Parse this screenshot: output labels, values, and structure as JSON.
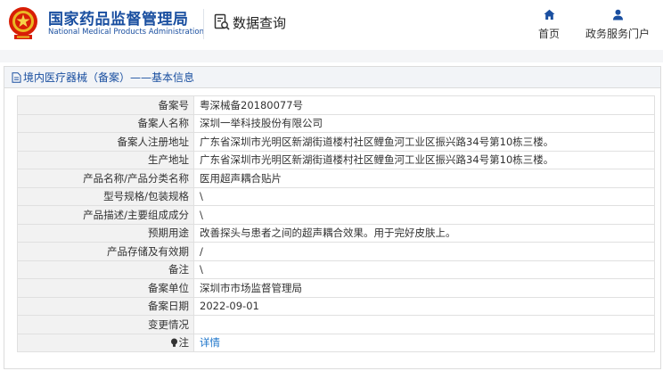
{
  "header": {
    "brand_cn": "国家药品监督管理局",
    "brand_en": "National Medical Products Administration",
    "query_label": "数据查询",
    "nav": [
      {
        "label": "首页",
        "icon": "home-icon"
      },
      {
        "label": "政务服务门户",
        "icon": "user-icon"
      }
    ],
    "brand_color": "#1a4fa0"
  },
  "section": {
    "title": "境内医疗器械（备案）——基本信息",
    "icon": "document-icon"
  },
  "rows": [
    {
      "label": "备案号",
      "value": "粤深械备20180077号"
    },
    {
      "label": "备案人名称",
      "value": "深圳一举科技股份有限公司"
    },
    {
      "label": "备案人注册地址",
      "value": "广东省深圳市光明区新湖街道楼村社区鲤鱼河工业区振兴路34号第10栋三楼。"
    },
    {
      "label": "生产地址",
      "value": "广东省深圳市光明区新湖街道楼村社区鲤鱼河工业区振兴路34号第10栋三楼。"
    },
    {
      "label": "产品名称/产品分类名称",
      "value": "医用超声耦合贴片"
    },
    {
      "label": "型号规格/包装规格",
      "value": "\\"
    },
    {
      "label": "产品描述/主要组成成分",
      "value": "\\"
    },
    {
      "label": "预期用途",
      "value": "改善探头与患者之间的超声耦合效果。用于完好皮肤上。"
    },
    {
      "label": "产品存储及有效期",
      "value": "/"
    },
    {
      "label": "备注",
      "value": "\\"
    },
    {
      "label": "备案单位",
      "value": "深圳市市场监督管理局"
    },
    {
      "label": "备案日期",
      "value": "2022-09-01"
    },
    {
      "label": "变更情况",
      "value": ""
    }
  ],
  "note_row": {
    "label": "注",
    "value": "详情",
    "icon": "lightbulb-icon"
  }
}
